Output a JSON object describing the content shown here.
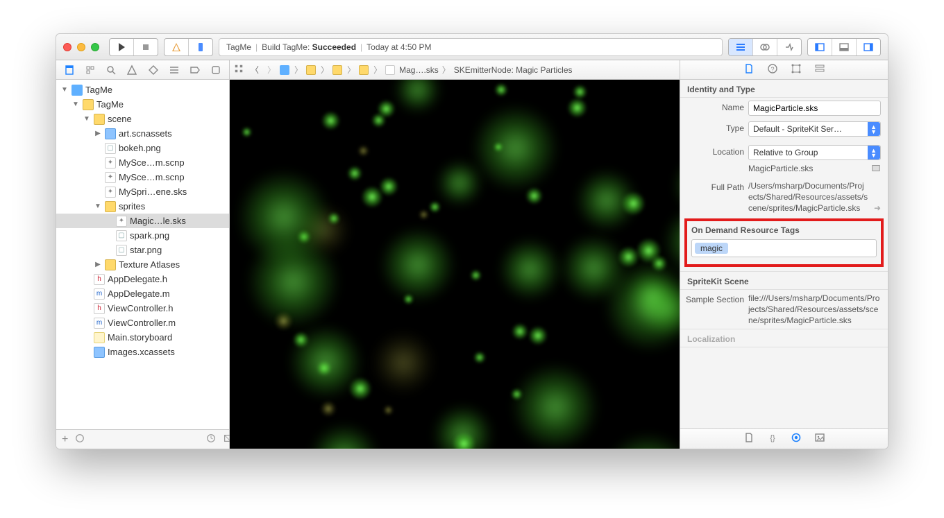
{
  "titlebar": {
    "project": "TagMe",
    "build_prefix": "Build TagMe:",
    "build_status": "Succeeded",
    "timestamp": "Today at 4:50 PM"
  },
  "navigator": {
    "tree": [
      {
        "d": 0,
        "open": true,
        "icon": "proj",
        "label": "TagMe"
      },
      {
        "d": 1,
        "open": true,
        "icon": "folder",
        "label": "TagMe"
      },
      {
        "d": 2,
        "open": true,
        "icon": "folder",
        "label": "scene"
      },
      {
        "d": 3,
        "open": false,
        "icon": "folder-blue",
        "label": "art.scnassets"
      },
      {
        "d": 3,
        "icon": "png",
        "label": "bokeh.png"
      },
      {
        "d": 3,
        "icon": "scene",
        "label": "MySce…m.scnp"
      },
      {
        "d": 3,
        "icon": "scene",
        "label": "MySce…m.scnp"
      },
      {
        "d": 3,
        "icon": "scene",
        "label": "MySpri…ene.sks"
      },
      {
        "d": 3,
        "open": true,
        "icon": "folder",
        "label": "sprites"
      },
      {
        "d": 4,
        "icon": "scene",
        "label": "Magic…le.sks",
        "sel": true
      },
      {
        "d": 4,
        "icon": "png",
        "label": "spark.png"
      },
      {
        "d": 4,
        "icon": "png",
        "label": "star.png"
      },
      {
        "d": 3,
        "open": false,
        "icon": "folder",
        "label": "Texture Atlases"
      },
      {
        "d": 2,
        "icon": "h",
        "label": "AppDelegate.h"
      },
      {
        "d": 2,
        "icon": "m",
        "label": "AppDelegate.m"
      },
      {
        "d": 2,
        "icon": "h",
        "label": "ViewController.h"
      },
      {
        "d": 2,
        "icon": "m",
        "label": "ViewController.m"
      },
      {
        "d": 2,
        "icon": "sb",
        "label": "Main.storyboard"
      },
      {
        "d": 2,
        "icon": "folder-blue",
        "label": "Images.xcassets"
      }
    ],
    "filter_placeholder": ""
  },
  "jumpbar": {
    "file": "Mag….sks",
    "node": "SKEmitterNode: Magic Particles"
  },
  "inspector": {
    "identity_title": "Identity and Type",
    "name_label": "Name",
    "name_value": "MagicParticle.sks",
    "type_label": "Type",
    "type_value": "Default - SpriteKit Ser…",
    "location_label": "Location",
    "location_value": "Relative to Group",
    "location_file": "MagicParticle.sks",
    "fullpath_label": "Full Path",
    "fullpath_value": "/Users/msharp/Documents/Projects/Shared/Resources/assets/scene/sprites/MagicParticle.sks",
    "odr_title": "On Demand Resource Tags",
    "odr_tag": "magic",
    "scene_title": "SpriteKit Scene",
    "sample_label": "Sample Section",
    "sample_value": "file:///Users/msharp/Documents/Projects/Shared/Resources/assets/scene/sprites/MagicParticle.sks",
    "localization_title": "Localization"
  }
}
